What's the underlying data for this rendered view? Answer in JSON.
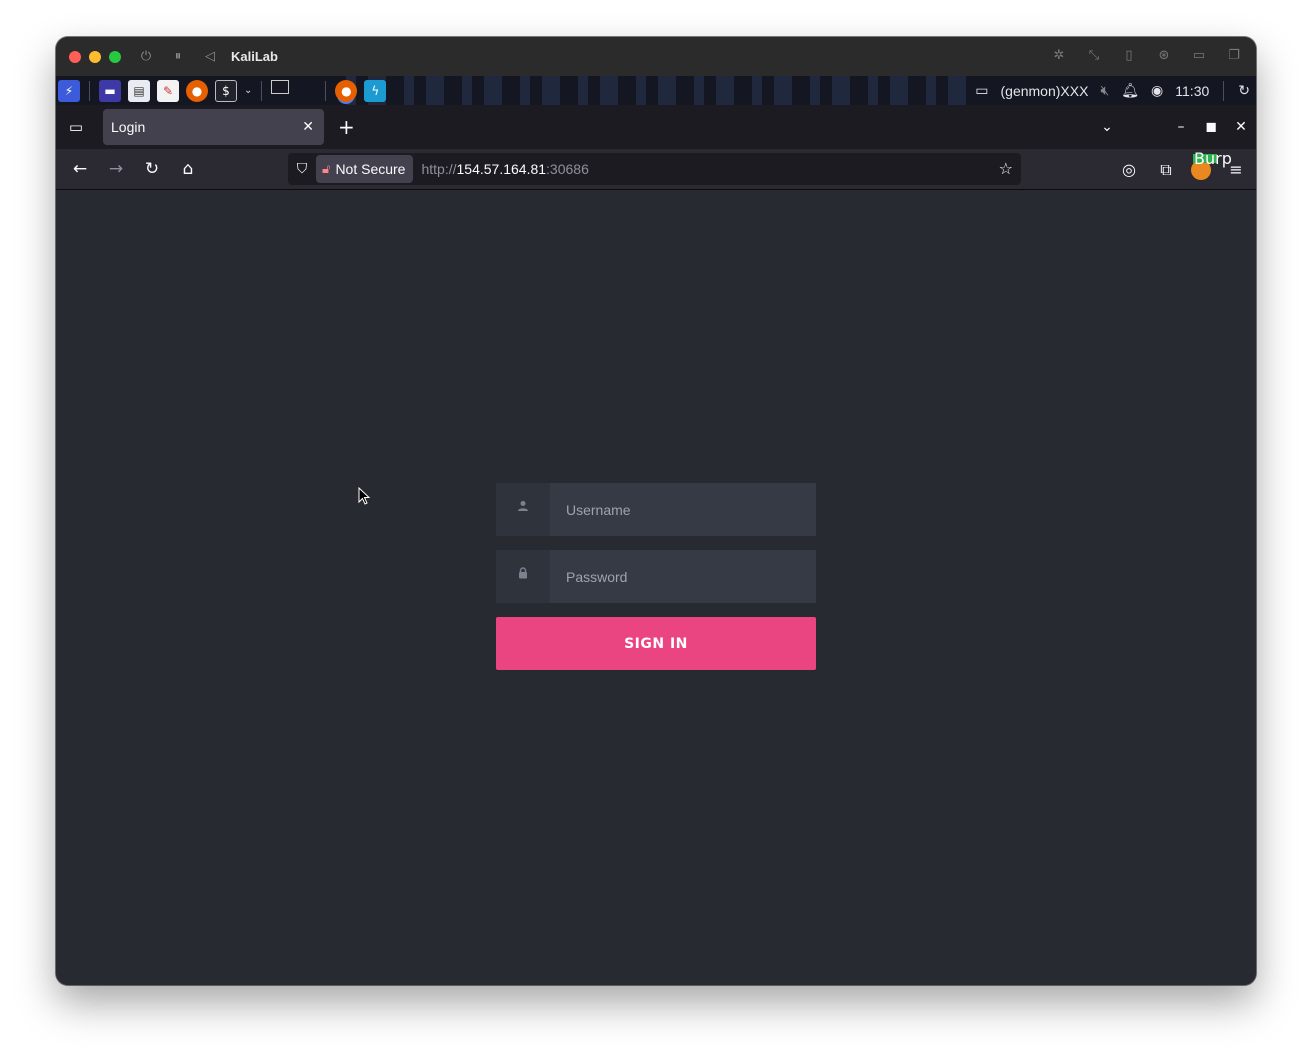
{
  "vm": {
    "title": "KaliLab"
  },
  "panel": {
    "genmon": "(genmon)XXX",
    "clock": "11:30"
  },
  "browser": {
    "tab_title": "Login",
    "not_secure_label": "Not Secure",
    "url_scheme": "http://",
    "url_host": "154.57.164.81",
    "url_port": ":30686",
    "burp_badge": "Burp"
  },
  "login": {
    "username_placeholder": "Username",
    "password_placeholder": "Password",
    "signin_label": "SIGN IN"
  },
  "colors": {
    "accent": "#ea4580",
    "page_bg": "#272b31"
  }
}
